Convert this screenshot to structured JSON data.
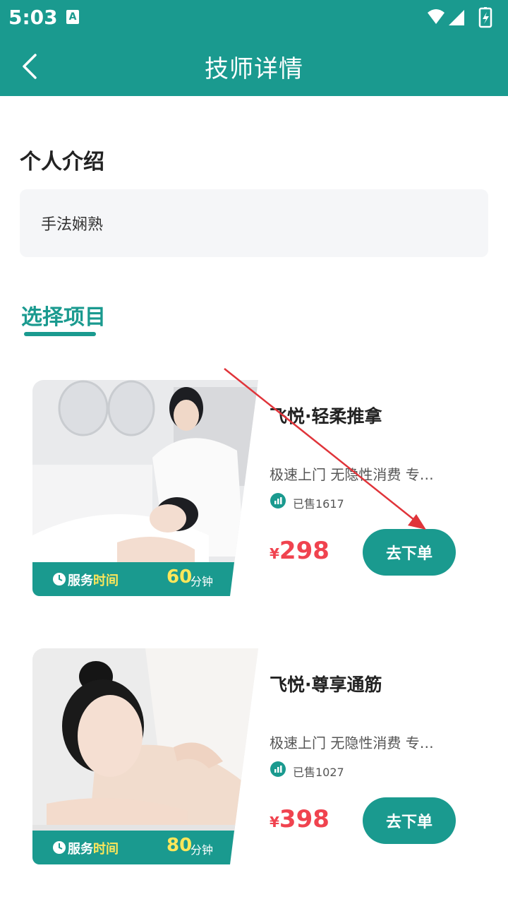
{
  "status_bar": {
    "time": "5:03",
    "notification_icon": "A"
  },
  "app_bar": {
    "title": "技师详情",
    "back_icon": "chevron-left-icon"
  },
  "intro": {
    "heading": "个人介绍",
    "text": "手法娴熟"
  },
  "tab": {
    "label": "选择项目"
  },
  "colors": {
    "accent": "#1a9a8f",
    "price": "#f0434f",
    "highlight": "#ffe75a"
  },
  "services": [
    {
      "name": "飞悦·轻柔推拿",
      "desc": "极速上门 无隐性消费 专业技师",
      "sold": "已售1617",
      "currency": "¥",
      "price": "298",
      "band_label_a": "服务",
      "band_label_b": "时间",
      "minutes": "60",
      "minutes_unit": "分钟",
      "order_label": "去下单"
    },
    {
      "name": "飞悦·尊享通筋",
      "desc": "极速上门 无隐性消费 专业技师",
      "sold": "已售1027",
      "currency": "¥",
      "price": "398",
      "band_label_a": "服务",
      "band_label_b": "时间",
      "minutes": "80",
      "minutes_unit": "分钟",
      "order_label": "去下单"
    }
  ]
}
